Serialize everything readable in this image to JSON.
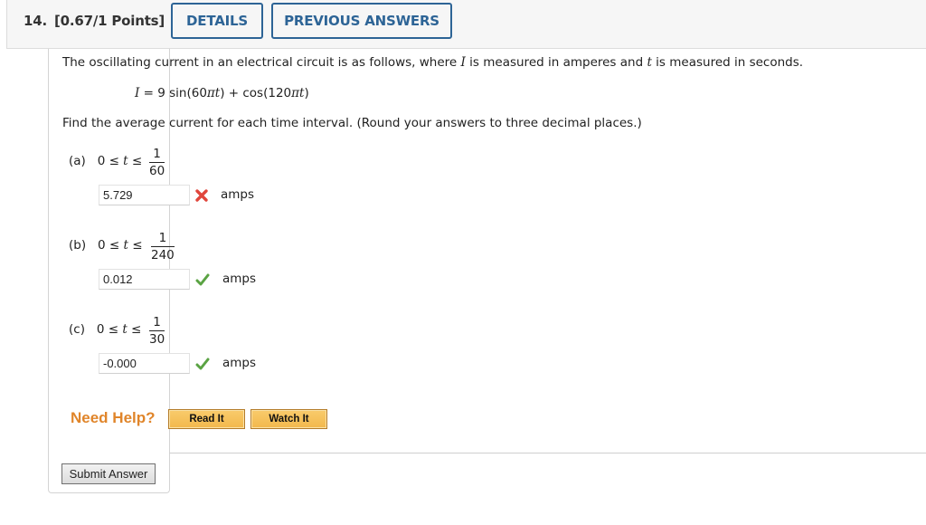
{
  "header": {
    "question_number": "14.",
    "points": "[0.67/1 Points]",
    "details_label": "DETAILS",
    "previous_answers_label": "PREVIOUS ANSWERS"
  },
  "problem": {
    "intro_before_I": "The oscillating current in an electrical circuit is as follows, where ",
    "var_I": "I",
    "intro_mid": " is measured in amperes and ",
    "var_t": "t",
    "intro_after": " is measured in seconds.",
    "formula_lhs": "I",
    "formula_rhs_1": " = 9 sin(60",
    "pi": "π",
    "formula_rhs_2": ") + cos(120",
    "formula_rhs_3": ")",
    "instruction": "Find the average current for each time interval. (Round your answers to three decimal places.)"
  },
  "parts": [
    {
      "label": "(a)",
      "inequality_prefix": "0 ≤ ",
      "var": "t",
      "inequality_suffix": " ≤ ",
      "numerator": "1",
      "denominator": "60",
      "answer": "5.729",
      "status": "incorrect",
      "unit": "amps"
    },
    {
      "label": "(b)",
      "inequality_prefix": "0 ≤ ",
      "var": "t",
      "inequality_suffix": " ≤ ",
      "numerator": "1",
      "denominator": "240",
      "answer": "0.012",
      "status": "correct",
      "unit": "amps"
    },
    {
      "label": "(c)",
      "inequality_prefix": "0 ≤ ",
      "var": "t",
      "inequality_suffix": " ≤ ",
      "numerator": "1",
      "denominator": "30",
      "answer": "-0.000",
      "status": "correct",
      "unit": "amps"
    }
  ],
  "help": {
    "need_help_label": "Need Help?",
    "read_it_label": "Read It",
    "watch_it_label": "Watch It"
  },
  "submit_label": "Submit Answer",
  "colors": {
    "accent_blue": "#2d6496",
    "incorrect_red": "#e0463c",
    "correct_green": "#5aa343",
    "help_orange": "#e0852a"
  }
}
